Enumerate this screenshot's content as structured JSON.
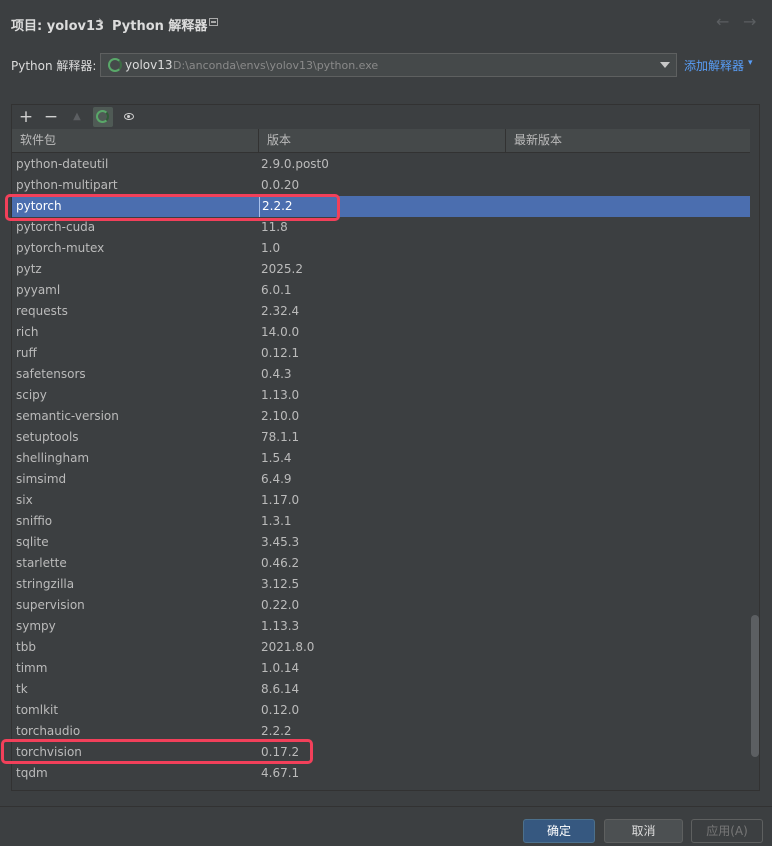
{
  "header": {
    "project": "项目: yolov13",
    "separator": "›",
    "page": "Python 解释器",
    "back": "←",
    "forward": "→"
  },
  "interpreter": {
    "label": "Python 解释器:",
    "name": "yolov13",
    "path": "D:\\anconda\\envs\\yolov13\\python.exe",
    "add_label": "添加解释器",
    "add_caret": "▾"
  },
  "toolbar": {
    "add": "+",
    "remove": "−",
    "upgrade": "▲"
  },
  "columns": {
    "package": "软件包",
    "version": "版本",
    "latest": "最新版本"
  },
  "packages": [
    {
      "name": "python-dateutil",
      "version": "2.9.0.post0"
    },
    {
      "name": "python-multipart",
      "version": "0.0.20"
    },
    {
      "name": "pytorch",
      "version": "2.2.2"
    },
    {
      "name": "pytorch-cuda",
      "version": "11.8"
    },
    {
      "name": "pytorch-mutex",
      "version": "1.0"
    },
    {
      "name": "pytz",
      "version": "2025.2"
    },
    {
      "name": "pyyaml",
      "version": "6.0.1"
    },
    {
      "name": "requests",
      "version": "2.32.4"
    },
    {
      "name": "rich",
      "version": "14.0.0"
    },
    {
      "name": "ruff",
      "version": "0.12.1"
    },
    {
      "name": "safetensors",
      "version": "0.4.3"
    },
    {
      "name": "scipy",
      "version": "1.13.0"
    },
    {
      "name": "semantic-version",
      "version": "2.10.0"
    },
    {
      "name": "setuptools",
      "version": "78.1.1"
    },
    {
      "name": "shellingham",
      "version": "1.5.4"
    },
    {
      "name": "simsimd",
      "version": "6.4.9"
    },
    {
      "name": "six",
      "version": "1.17.0"
    },
    {
      "name": "sniffio",
      "version": "1.3.1"
    },
    {
      "name": "sqlite",
      "version": "3.45.3"
    },
    {
      "name": "starlette",
      "version": "0.46.2"
    },
    {
      "name": "stringzilla",
      "version": "3.12.5"
    },
    {
      "name": "supervision",
      "version": "0.22.0"
    },
    {
      "name": "sympy",
      "version": "1.13.3"
    },
    {
      "name": "tbb",
      "version": "2021.8.0"
    },
    {
      "name": "timm",
      "version": "1.0.14"
    },
    {
      "name": "tk",
      "version": "8.6.14"
    },
    {
      "name": "tomlkit",
      "version": "0.12.0"
    },
    {
      "name": "torchaudio",
      "version": "2.2.2"
    },
    {
      "name": "torchvision",
      "version": "0.17.2"
    },
    {
      "name": "tqdm",
      "version": "4.67.1"
    }
  ],
  "selected_package": "pytorch",
  "colors": {
    "selection": "#4b6eaf",
    "highlight": "#f2405a",
    "link": "#589df6",
    "background": "#3c3f41"
  },
  "footer": {
    "ok": "确定",
    "cancel": "取消",
    "apply": "应用(A)"
  }
}
